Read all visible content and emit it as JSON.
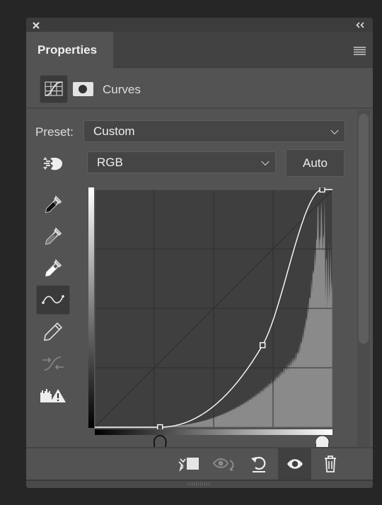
{
  "window": {
    "close_icon": "close-icon",
    "collapse_icon": "double-chevron-left-icon"
  },
  "tabs": [
    {
      "label": "Properties",
      "active": true
    }
  ],
  "panel_menu_icon": "hamburger-menu-icon",
  "header": {
    "adjustment_label": "Curves",
    "adjustment_icon": "curves-icon",
    "mask_icon": "mask-icon"
  },
  "preset": {
    "label": "Preset:",
    "value": "Custom"
  },
  "channel": {
    "value": "RGB",
    "auto_label": "Auto",
    "target_icon": "on-image-adjustment-icon"
  },
  "tools": [
    {
      "name": "black-point-eyedropper-icon"
    },
    {
      "name": "gray-point-eyedropper-icon"
    },
    {
      "name": "white-point-eyedropper-icon"
    },
    {
      "name": "curve-points-icon",
      "active": true
    },
    {
      "name": "pencil-icon"
    },
    {
      "name": "smooth-curve-icon",
      "disabled": true
    },
    {
      "name": "clipping-warning-icon"
    }
  ],
  "curve": {
    "range": [
      0,
      255
    ],
    "points": [
      [
        0,
        0
      ],
      [
        70,
        0
      ],
      [
        180,
        88
      ],
      [
        244,
        255
      ],
      [
        255,
        255
      ]
    ],
    "black_slider": 70,
    "white_slider": 244
  },
  "colors": {
    "panel": "#535353",
    "graph_bg": "#3f3f3f",
    "histogram": "#8a8a8a",
    "curve": "#ffffff"
  },
  "bottom": [
    {
      "name": "clip-to-layer-icon"
    },
    {
      "name": "view-previous-state-icon",
      "disabled": true
    },
    {
      "name": "reset-icon"
    },
    {
      "name": "visibility-eye-icon",
      "active": true
    },
    {
      "name": "trash-icon"
    }
  ]
}
